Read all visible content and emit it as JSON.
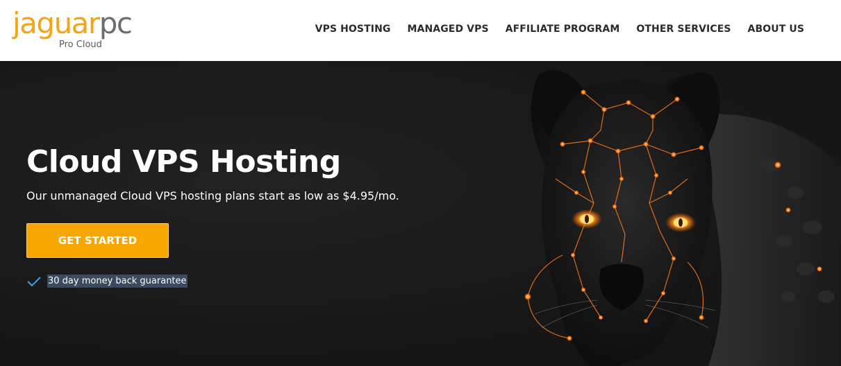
{
  "logo": {
    "word_a": "jaguar",
    "word_b": "pc",
    "tagline": "Pro Cloud"
  },
  "nav": {
    "items": [
      {
        "label": "VPS HOSTING"
      },
      {
        "label": "MANAGED VPS"
      },
      {
        "label": "AFFILIATE PROGRAM"
      },
      {
        "label": "OTHER SERVICES"
      },
      {
        "label": "ABOUT US"
      }
    ]
  },
  "hero": {
    "title": "Cloud VPS Hosting",
    "subtitle": "Our unmanaged Cloud VPS hosting plans start as low as $4.95/mo.",
    "cta_label": "GET STARTED",
    "guarantee": "30 day money back guarantee",
    "image_icon": "panther-circuit-illustration"
  },
  "colors": {
    "accent": "#f7a600",
    "hero_bg": "#181818",
    "nav_text": "#2b2b2b",
    "highlight": "#3b4a5e",
    "check": "#3fa3e6"
  }
}
